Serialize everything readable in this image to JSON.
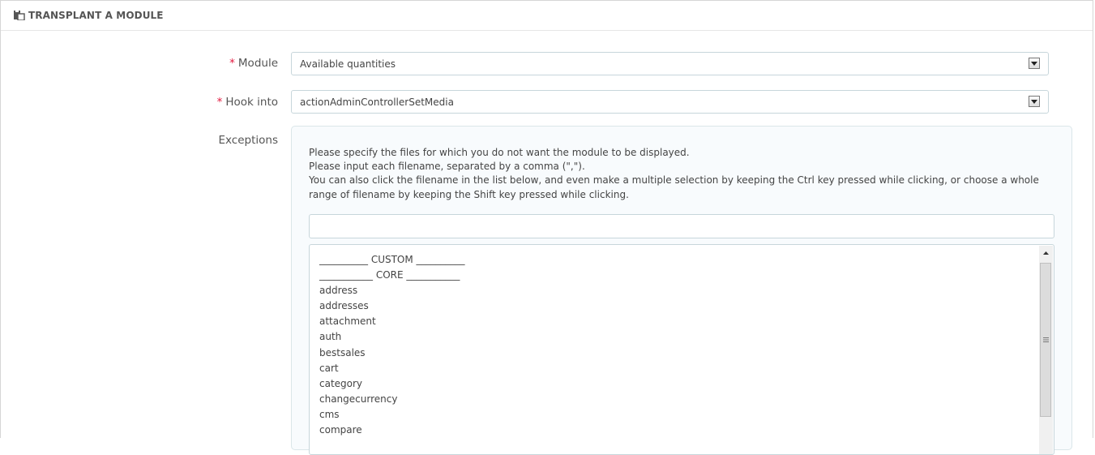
{
  "panel": {
    "title": "TRANSPLANT A MODULE",
    "icon": "paste-icon"
  },
  "form": {
    "module": {
      "label": "Module",
      "required": "*",
      "value": "Available quantities"
    },
    "hook": {
      "label": "Hook into",
      "required": "*",
      "value": "actionAdminControllerSetMedia"
    },
    "exceptions": {
      "label": "Exceptions",
      "help": [
        "Please specify the files for which you do not want the module to be displayed.",
        "Please input each filename, separated by a comma (\",\").",
        "You can also click the filename in the list below, and even make a multiple selection by keeping the Ctrl key pressed while clicking, or choose a whole range of filename by keeping the Shift key pressed while clicking."
      ],
      "input_value": "",
      "options": [
        "__________ CUSTOM __________",
        "___________ CORE ___________",
        "address",
        "addresses",
        "attachment",
        "auth",
        "bestsales",
        "cart",
        "category",
        "changecurrency",
        "cms",
        "compare"
      ]
    }
  }
}
